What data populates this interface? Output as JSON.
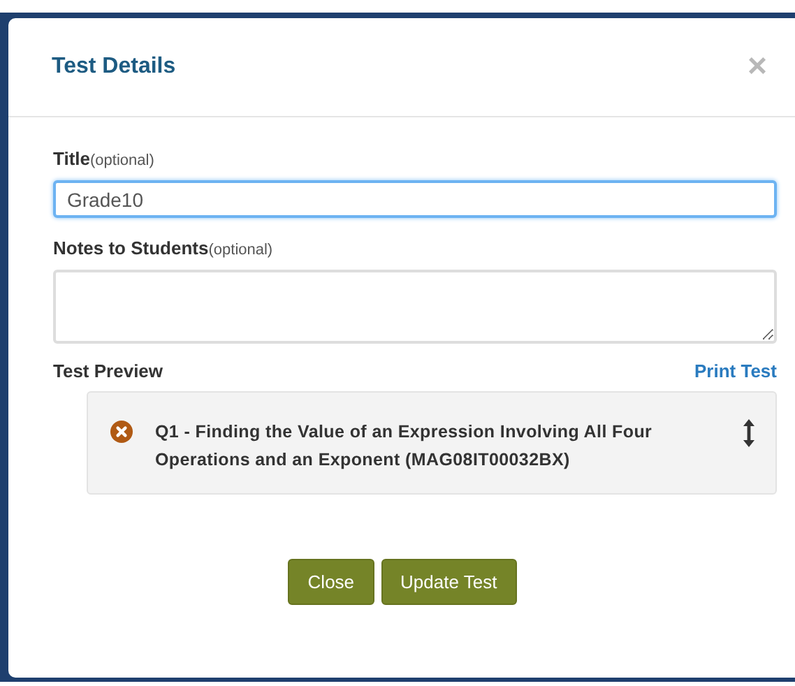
{
  "dialog": {
    "title": "Test Details",
    "close_glyph": "×"
  },
  "fields": [
    {
      "kind": "input",
      "label": "Title",
      "hint": "(optional)",
      "value": "Grade10",
      "focused": true
    },
    {
      "kind": "textarea",
      "label": "Notes to Students",
      "hint": "(optional)",
      "focused": false
    }
  ],
  "preview": {
    "label": "Test Preview",
    "link": "Print Test",
    "items": [
      {
        "text": "Q1 - Finding the Value of an Expression Involving All Four Operations and an Exponent (MAG08IT00032BX)"
      }
    ]
  },
  "buttons": [
    "Close",
    "Update Test"
  ]
}
